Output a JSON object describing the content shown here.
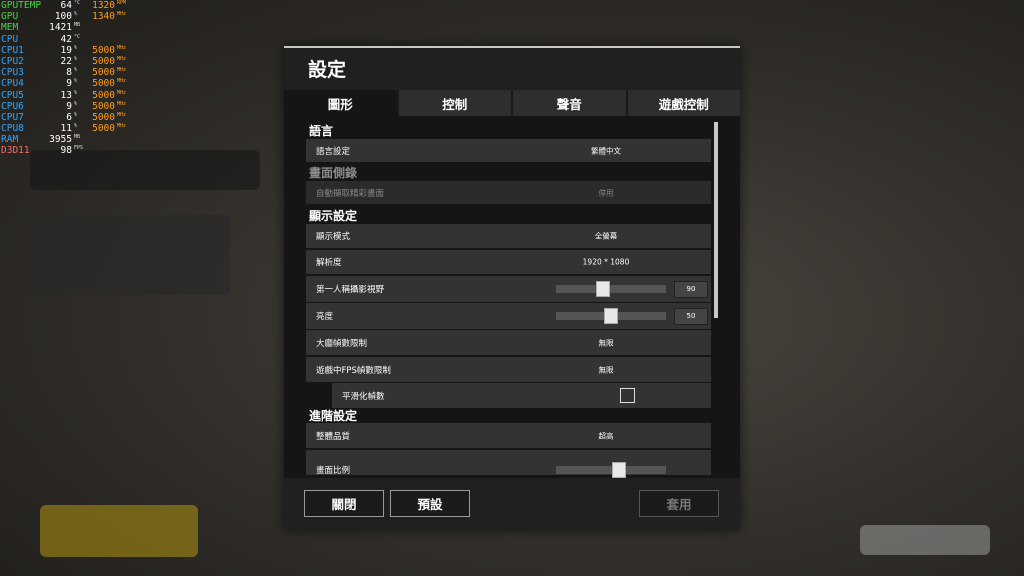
{
  "osd": [
    {
      "label": "GPUTEMP",
      "value": "64",
      "unit": "°C",
      "value2": "1320",
      "unit2": "RPM",
      "color": "#47d447"
    },
    {
      "label": "GPU",
      "value": "100",
      "unit": "%",
      "value2": "1340",
      "unit2": "MHz",
      "color": "#47d447"
    },
    {
      "label": "MEM",
      "value": "1421",
      "unit": "MB",
      "value2": "",
      "unit2": "",
      "color": "#47d447"
    },
    {
      "label": "CPU",
      "value": "42",
      "unit": "°C",
      "value2": "",
      "unit2": "",
      "color": "#2aa7ff"
    },
    {
      "label": "CPU1",
      "value": "19",
      "unit": "%",
      "value2": "5000",
      "unit2": "MHz",
      "color": "#2aa7ff"
    },
    {
      "label": "CPU2",
      "value": "22",
      "unit": "%",
      "value2": "5000",
      "unit2": "MHz",
      "color": "#2aa7ff"
    },
    {
      "label": "CPU3",
      "value": "8",
      "unit": "%",
      "value2": "5000",
      "unit2": "MHz",
      "color": "#2aa7ff"
    },
    {
      "label": "CPU4",
      "value": "9",
      "unit": "%",
      "value2": "5000",
      "unit2": "MHz",
      "color": "#2aa7ff"
    },
    {
      "label": "CPU5",
      "value": "13",
      "unit": "%",
      "value2": "5000",
      "unit2": "MHz",
      "color": "#2aa7ff"
    },
    {
      "label": "CPU6",
      "value": "9",
      "unit": "%",
      "value2": "5000",
      "unit2": "MHz",
      "color": "#2aa7ff"
    },
    {
      "label": "CPU7",
      "value": "6",
      "unit": "%",
      "value2": "5000",
      "unit2": "MHz",
      "color": "#2aa7ff"
    },
    {
      "label": "CPU8",
      "value": "11",
      "unit": "%",
      "value2": "5000",
      "unit2": "MHz",
      "color": "#2aa7ff"
    },
    {
      "label": "RAM",
      "value": "3955",
      "unit": "MB",
      "value2": "",
      "unit2": "",
      "color": "#2aa7ff"
    },
    {
      "label": "D3D11",
      "value": "98",
      "unit": "FPS",
      "value2": "",
      "unit2": "",
      "color": "#ff6a6a"
    }
  ],
  "dialog": {
    "title": "設定",
    "tabs": [
      "圖形",
      "控制",
      "聲音",
      "遊戲控制"
    ],
    "active_tab": "圖形",
    "sections": {
      "language": "語言",
      "replay": "畫面側錄",
      "display": "顯示設定",
      "advanced": "進階設定"
    },
    "rows": {
      "language_setting": {
        "label": "語言設定",
        "value": "繁體中文"
      },
      "auto_capture": {
        "label": "自動擷取精彩畫面",
        "value": "停用"
      },
      "display_mode": {
        "label": "顯示模式",
        "value": "全螢幕"
      },
      "resolution": {
        "label": "解析度",
        "value": "1920 * 1080"
      },
      "fpp_fov": {
        "label": "第一人稱攝影視野",
        "value": "90",
        "level": 0.42
      },
      "brightness": {
        "label": "亮度",
        "value": "50",
        "level": 0.5
      },
      "lobby_fps": {
        "label": "大廳幀數限制",
        "value": "無限"
      },
      "ingame_fps": {
        "label": "遊戲中FPS幀數限制",
        "value": "無限"
      },
      "smoothing": {
        "label": "平滑化幀數",
        "checked": false
      },
      "overall_quality": {
        "label": "整體品質",
        "value": "超高"
      },
      "screen_scale": {
        "label": "畫面比例"
      }
    },
    "buttons": {
      "close": "關閉",
      "default": "預設",
      "apply": "套用"
    }
  }
}
